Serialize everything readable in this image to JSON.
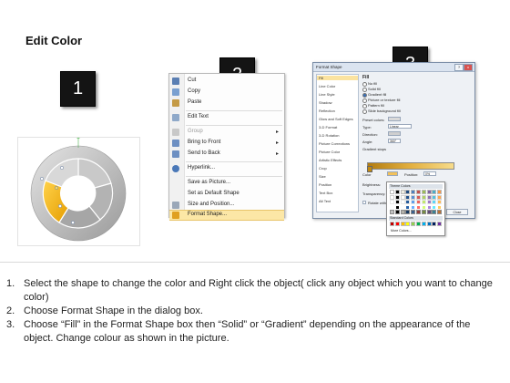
{
  "heading": "Edit Color",
  "steps_badges": [
    "1",
    "2",
    "3"
  ],
  "colors": {
    "badge_bg": "#141414",
    "donut_highlight": "#f5b700",
    "menu_highlight": "#fce7a6",
    "gradient_stop": "#e3b040"
  },
  "context_menu": {
    "items": [
      {
        "label": "Cut",
        "icon": "scissors-icon"
      },
      {
        "label": "Copy",
        "icon": "copy-icon"
      },
      {
        "label": "Paste",
        "icon": "paste-icon"
      },
      {
        "label": "Edit Text",
        "icon": "edit-text-icon"
      },
      {
        "label": "Group",
        "icon": "group-icon",
        "disabled": true,
        "submenu": true
      },
      {
        "label": "Bring to Front",
        "icon": "bring-front-icon",
        "submenu": true
      },
      {
        "label": "Send to Back",
        "icon": "send-back-icon",
        "submenu": true
      },
      {
        "label": "Hyperlink...",
        "icon": "hyperlink-icon"
      },
      {
        "label": "Save as Picture...",
        "icon": ""
      },
      {
        "label": "Set as Default Shape",
        "icon": ""
      },
      {
        "label": "Size and Position...",
        "icon": "size-icon"
      },
      {
        "label": "Format Shape...",
        "icon": "format-shape-icon",
        "highlighted": true
      }
    ]
  },
  "format_dialog": {
    "title": "Format Shape",
    "categories": [
      "Fill",
      "Line Color",
      "Line Style",
      "Shadow",
      "Reflection",
      "Glow and Soft Edges",
      "3-D Format",
      "3-D Rotation",
      "Picture Corrections",
      "Picture Color",
      "Artistic Effects",
      "Crop",
      "Size",
      "Position",
      "Text Box",
      "Alt Text"
    ],
    "section_title": "Fill",
    "fill_options": [
      "No fill",
      "Solid fill",
      "Gradient fill",
      "Picture or texture fill",
      "Pattern fill",
      "Slide background fill"
    ],
    "selected_fill": "Gradient fill",
    "preset_colors_label": "Preset colors:",
    "type_label": "Type:",
    "type_value": "Linear",
    "direction_label": "Direction:",
    "angle_label": "Angle:",
    "angle_value": "360°",
    "gradient_stops_label": "Gradient stops",
    "color_label": "Color",
    "position_label": "Position:",
    "position_value": "0%",
    "brightness_label": "Brightness:",
    "transparency_label": "Transparency:",
    "rotate_label": "Rotate with shape",
    "close_button": "Close",
    "palette": {
      "theme_colors_label": "Theme Colors",
      "standard_colors_label": "Standard Colors",
      "more_colors_label": "More Colors...",
      "theme_top_row": [
        "#ffffff",
        "#000000",
        "#eeece1",
        "#1f497d",
        "#4f81bd",
        "#c0504d",
        "#9bbb59",
        "#8064a2",
        "#4bacc6",
        "#f79646"
      ],
      "standard_row": [
        "#c00000",
        "#ff0000",
        "#ffc000",
        "#ffff00",
        "#92d050",
        "#00b050",
        "#00b0f0",
        "#0070c0",
        "#002060",
        "#7030a0"
      ]
    }
  },
  "instructions": [
    {
      "num": "1.",
      "text": "Select the shape to change the color and Right click the object( click any object which you want to change color)"
    },
    {
      "num": "2.",
      "text": "Choose Format Shape in the dialog box."
    },
    {
      "num": "3.",
      "text": "Choose “Fill” in the Format Shape box then “Solid” or “Gradient” depending on the appearance of the object. Change colour as shown in the picture."
    }
  ]
}
